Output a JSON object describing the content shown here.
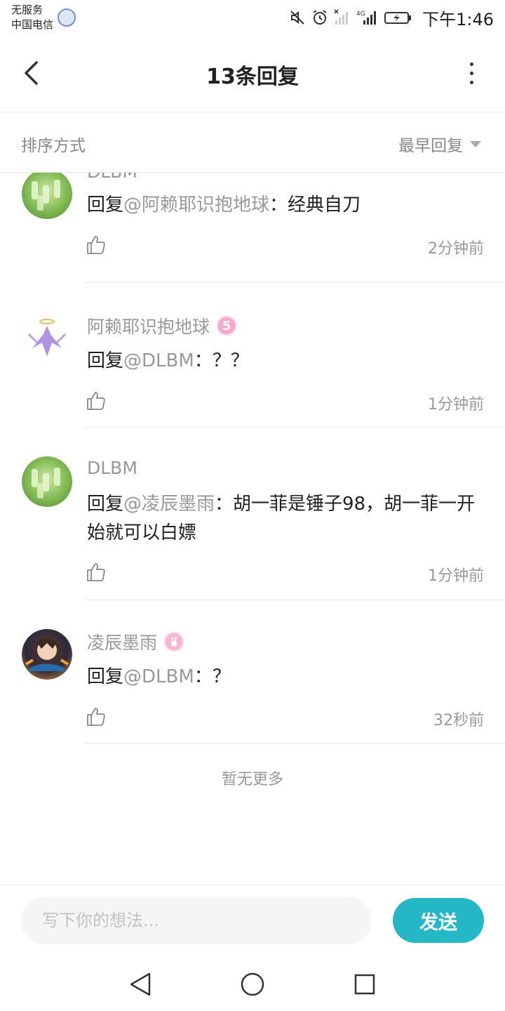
{
  "status_bar": {
    "carrier_line1": "无服务",
    "carrier_line2": "中国电信",
    "time": "下午1:46",
    "network_label": "4G"
  },
  "header": {
    "title": "13条回复"
  },
  "sort": {
    "label": "排序方式",
    "selected": "最早回复"
  },
  "replies": [
    {
      "name": "DLBM",
      "avatar": "green-bottles",
      "badge": "",
      "prefix": "回复",
      "mention": "@阿赖耶识抱地球",
      "text": "：经典自刀",
      "time": "2分钟前"
    },
    {
      "name": "阿赖耶识抱地球",
      "avatar": "angel-figure",
      "badge": "5",
      "prefix": "回复",
      "mention": "@DLBM",
      "text": "：？？",
      "time": "1分钟前"
    },
    {
      "name": "DLBM",
      "avatar": "green-bottles",
      "badge": "",
      "prefix": "回复",
      "mention": "@凌辰墨雨",
      "text": "：胡一菲是锤子98，胡一菲一开始就可以白嫖",
      "time": "1分钟前"
    },
    {
      "name": "凌辰墨雨",
      "avatar": "anime-character",
      "badge": "bunny",
      "prefix": "回复",
      "mention": "@DLBM",
      "text": "：？",
      "time": "32秒前"
    }
  ],
  "footer_note": "暂无更多",
  "composer": {
    "placeholder": "写下你的想法...",
    "send_label": "发送"
  },
  "colors": {
    "accent": "#25b7c5",
    "muted_text": "#999999",
    "body_text": "#222222"
  },
  "icons": {
    "back": "chevron-left-icon",
    "more": "vertical-dots-icon",
    "like": "thumbs-up-icon",
    "nav_back": "triangle-back-icon",
    "nav_home": "circle-home-icon",
    "nav_recents": "square-recents-icon"
  }
}
